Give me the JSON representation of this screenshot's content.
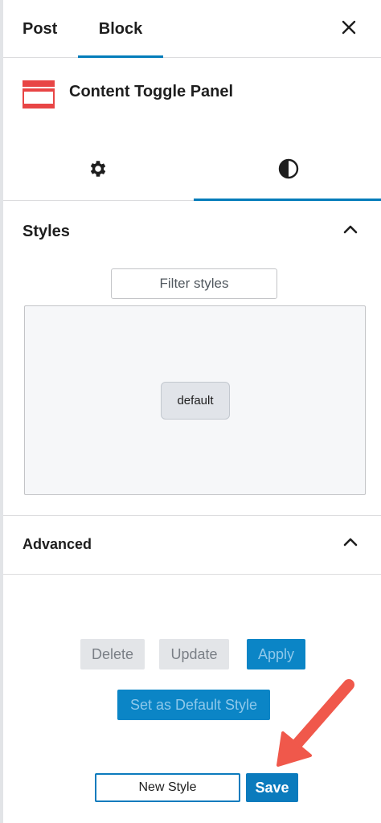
{
  "tabs": {
    "post_label": "Post",
    "block_label": "Block",
    "close_icon": "close-icon"
  },
  "block": {
    "title": "Content Toggle Panel",
    "icon": "toggle-panel-icon",
    "icon_color": "#e84545"
  },
  "switch": {
    "settings_icon": "gear-icon",
    "styles_icon": "contrast-icon"
  },
  "styles": {
    "title": "Styles",
    "filter_placeholder": "Filter styles",
    "items": [
      {
        "label": "default"
      }
    ]
  },
  "advanced": {
    "title": "Advanced"
  },
  "actions": {
    "delete_label": "Delete",
    "update_label": "Update",
    "apply_label": "Apply",
    "set_default_label": "Set as Default Style",
    "new_style_label": "New Style",
    "save_label": "Save"
  },
  "colors": {
    "accent": "#007cba",
    "annotation_arrow": "#f0584b"
  }
}
